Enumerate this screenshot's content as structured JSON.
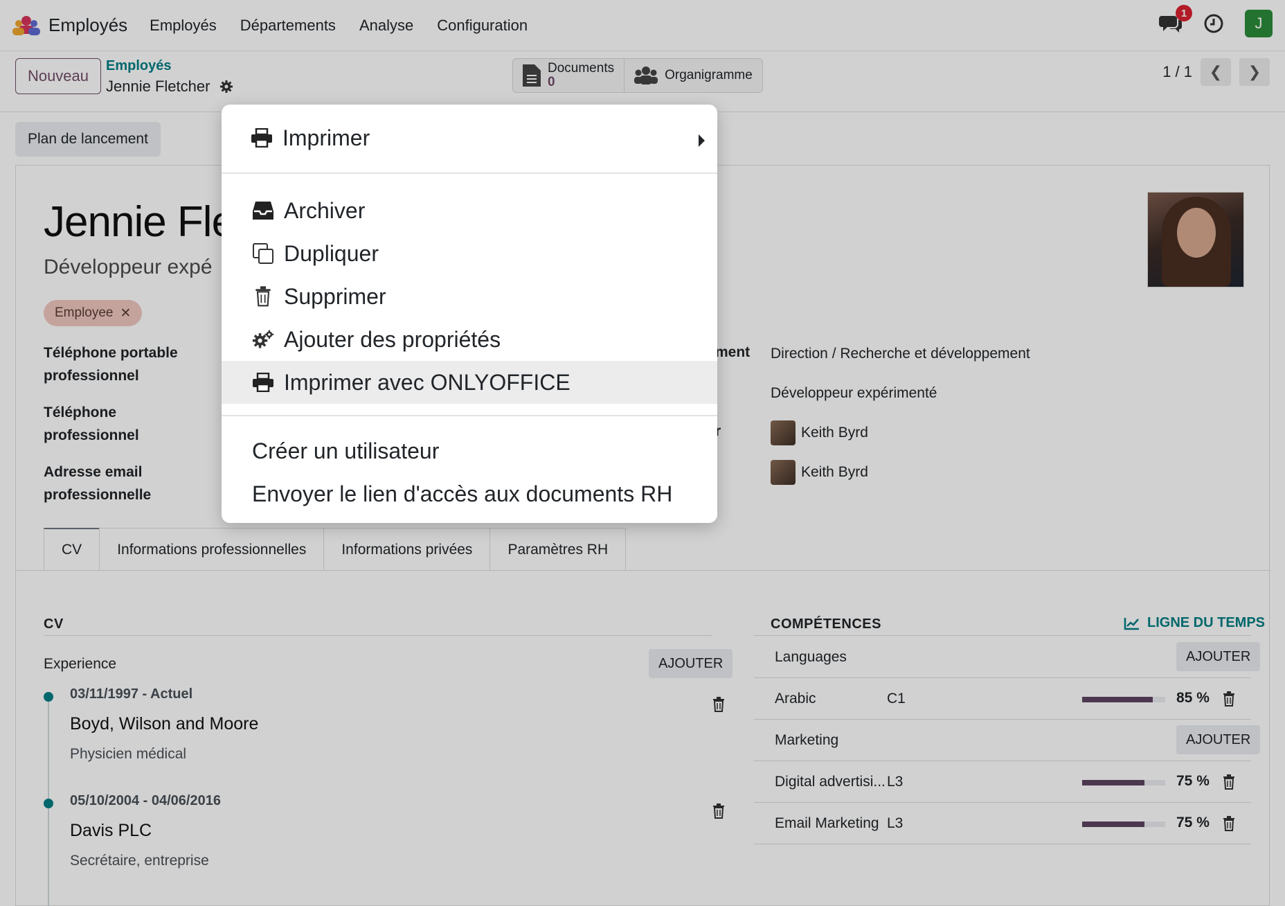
{
  "navbar": {
    "app_name": "Employés",
    "menu": [
      "Employés",
      "Départements",
      "Analyse",
      "Configuration"
    ],
    "chat_badge": "1",
    "user_initial": "J",
    "user_color": "#2c8b3a"
  },
  "control": {
    "new_label": "Nouveau",
    "breadcrumb_parent": "Employés",
    "breadcrumb_current": "Jennie Fletcher",
    "documents_label": "Documents",
    "documents_count": "0",
    "org_label": "Organigramme",
    "pager": "1 / 1"
  },
  "sheet": {
    "launch_plan": "Plan de lancement",
    "name": "Jennie Fle",
    "job": "Développeur expé",
    "tag": "Employee",
    "fields_left": [
      {
        "label": "Téléphone portable professionnel"
      },
      {
        "label": "Téléphone professionnel"
      },
      {
        "label": "Adresse email professionnelle"
      }
    ],
    "right_label_fragment": "ment",
    "right_label_fragment2": "r",
    "department": "Direction / Recherche et développement",
    "job_position": "Développeur expérimenté",
    "manager": "Keith Byrd",
    "coach": "Keith Byrd"
  },
  "tabs": [
    "CV",
    "Informations professionnelles",
    "Informations privées",
    "Paramètres RH"
  ],
  "cv": {
    "section_title": "CV",
    "experience_label": "Experience",
    "add_label": "AJOUTER",
    "entries": [
      {
        "date": "03/11/1997 - Actuel",
        "company": "Boyd, Wilson and Moore",
        "role": "Physicien médical"
      },
      {
        "date": "05/10/2004 - 04/06/2016",
        "company": "Davis PLC",
        "role": "Secrétaire, entreprise"
      }
    ]
  },
  "skills": {
    "section_title": "COMPÉTENCES",
    "timeline_label": "LIGNE DU TEMPS",
    "add_label": "AJOUTER",
    "categories": [
      {
        "name": "Languages",
        "items": [
          {
            "name": "Arabic",
            "level": "C1",
            "progress": 85,
            "pct_label": "85 %"
          }
        ]
      },
      {
        "name": "Marketing",
        "items": [
          {
            "name": "Digital advertisi...",
            "level": "L3",
            "progress": 75,
            "pct_label": "75 %"
          },
          {
            "name": "Email Marketing",
            "level": "L3",
            "progress": 75,
            "pct_label": "75 %"
          }
        ]
      }
    ]
  },
  "menu": {
    "print": "Imprimer",
    "archive": "Archiver",
    "duplicate": "Dupliquer",
    "delete": "Supprimer",
    "add_props": "Ajouter des propriétés",
    "print_onlyoffice": "Imprimer avec ONLYOFFICE",
    "create_user": "Créer un utilisateur",
    "send_link": "Envoyer le lien d'accès aux documents RH"
  }
}
